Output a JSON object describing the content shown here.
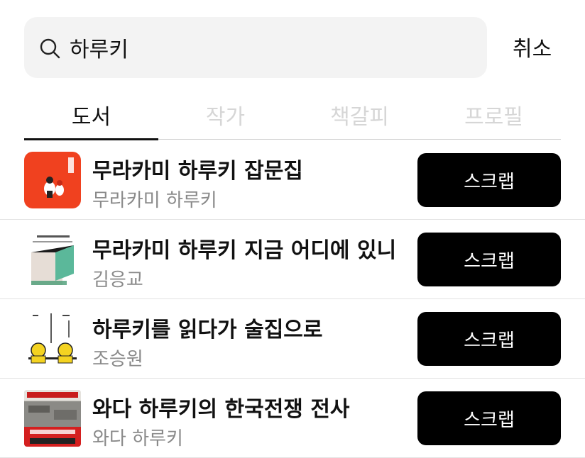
{
  "search": {
    "value": "하루키",
    "cancel_label": "취소"
  },
  "tabs": [
    {
      "label": "도서",
      "active": true
    },
    {
      "label": "작가",
      "active": false
    },
    {
      "label": "책갈피",
      "active": false
    },
    {
      "label": "프로필",
      "active": false
    }
  ],
  "results": [
    {
      "title": "무라카미 하루키 잡문집",
      "author": "무라카미 하루키",
      "button": "스크랩",
      "cover_icon": "book-cover-orange"
    },
    {
      "title": "무라카미 하루키 지금 어디에 있니",
      "author": "김응교",
      "button": "스크랩",
      "cover_icon": "book-cover-haruki"
    },
    {
      "title": "하루키를 읽다가 술집으로",
      "author": "조승원",
      "button": "스크랩",
      "cover_icon": "book-cover-illustration"
    },
    {
      "title": "와다 하루키의 한국전쟁 전사",
      "author": "와다 하루키",
      "button": "스크랩",
      "cover_icon": "book-cover-war"
    }
  ],
  "colors": {
    "accent": "#000000",
    "tab_inactive": "#d6d6d6",
    "search_bg": "#f3f3f3"
  }
}
